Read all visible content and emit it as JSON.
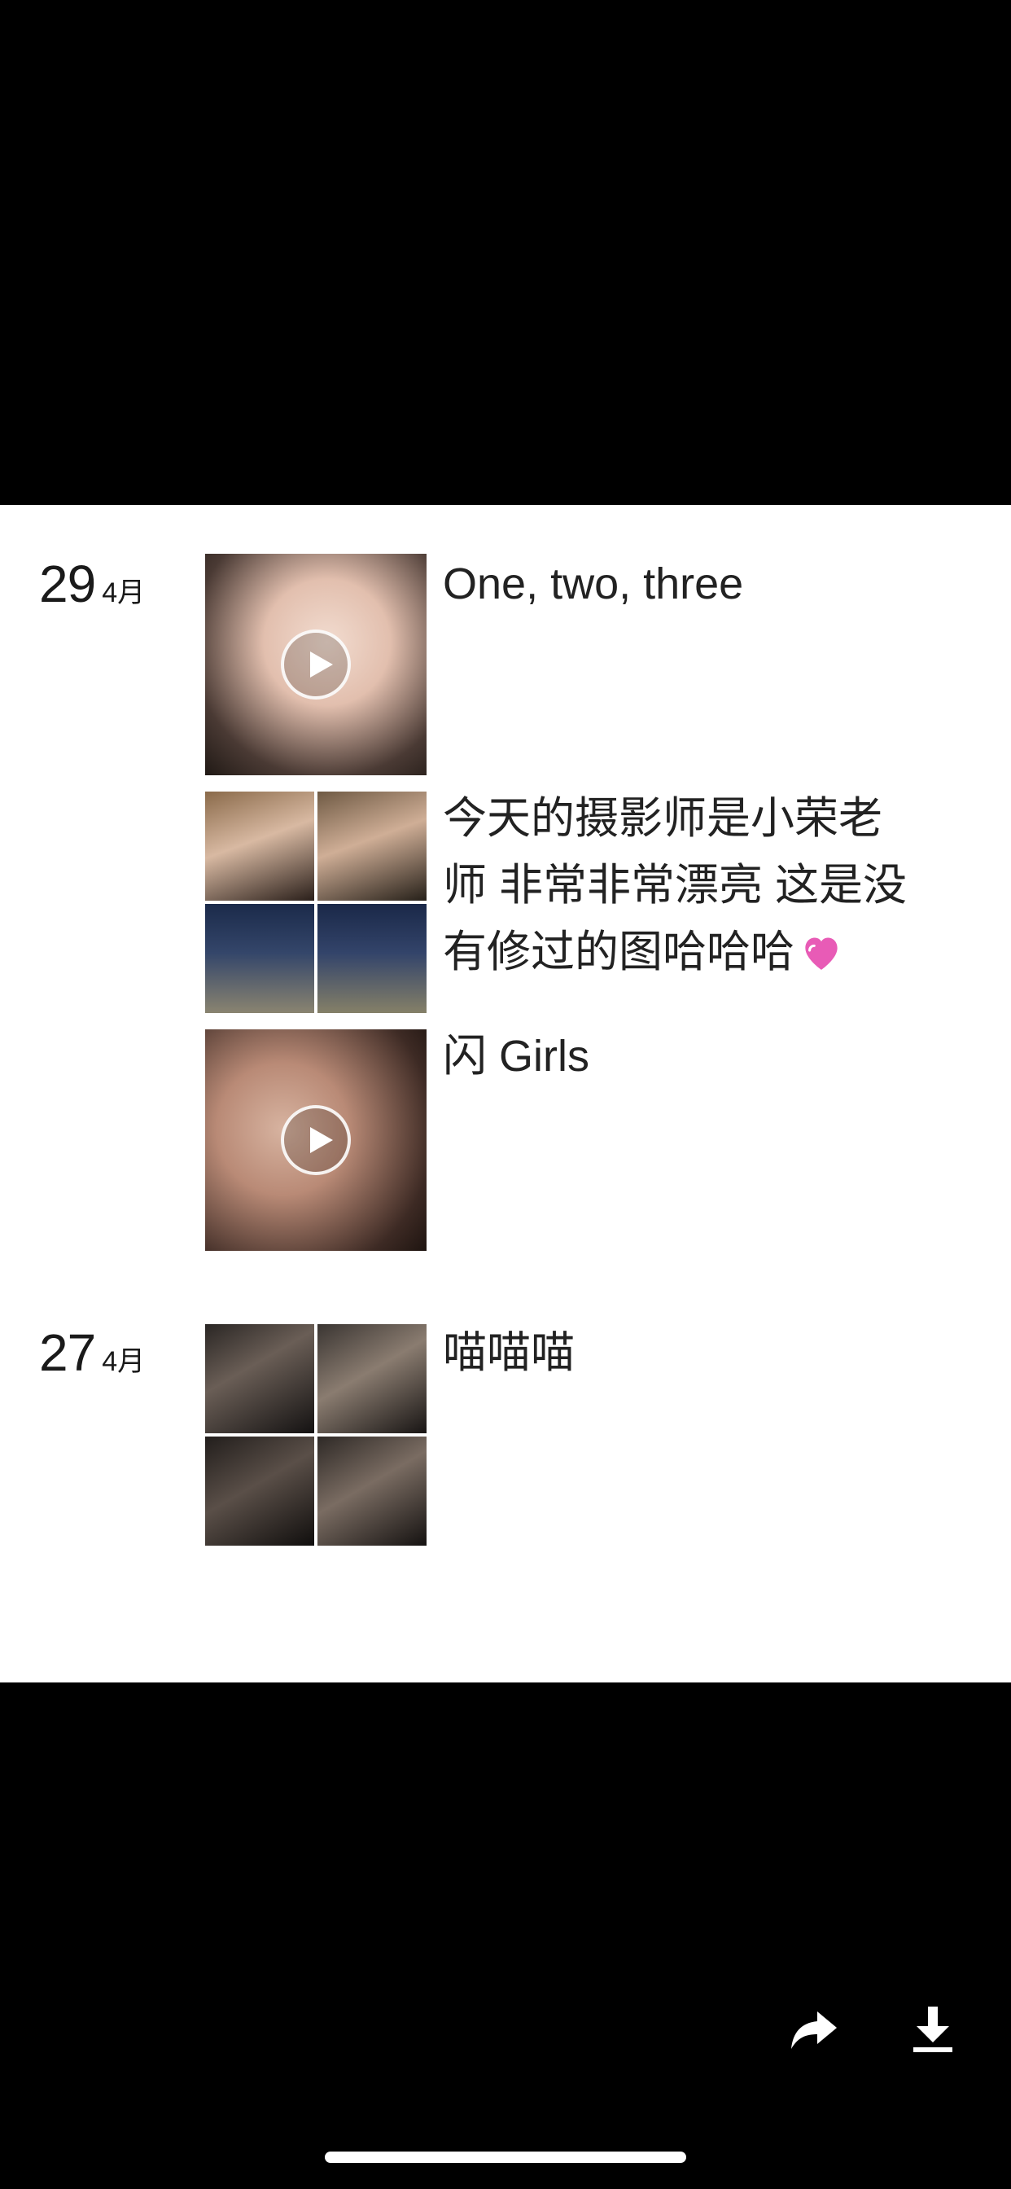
{
  "posts": [
    {
      "day": "29",
      "month": "4月",
      "entries": [
        {
          "caption": "One, two, three",
          "media": "video"
        },
        {
          "caption_lines": [
            "今天的摄影师是小荣老",
            "师 非常非常漂亮 这是没",
            "有修过的图哈哈哈"
          ],
          "media": "photo-grid",
          "emoji": "heart-icon"
        },
        {
          "caption": "闪 Girls",
          "media": "video"
        }
      ]
    },
    {
      "day": "27",
      "month": "4月",
      "entries": [
        {
          "caption": "喵喵喵",
          "media": "photo-grid"
        }
      ]
    }
  ],
  "toolbar": {
    "share_icon": "share-icon",
    "download_icon": "download-icon"
  },
  "colors": {
    "background": "#000000",
    "panel": "#ffffff",
    "text": "#222222",
    "heart": "#e85bb6"
  }
}
